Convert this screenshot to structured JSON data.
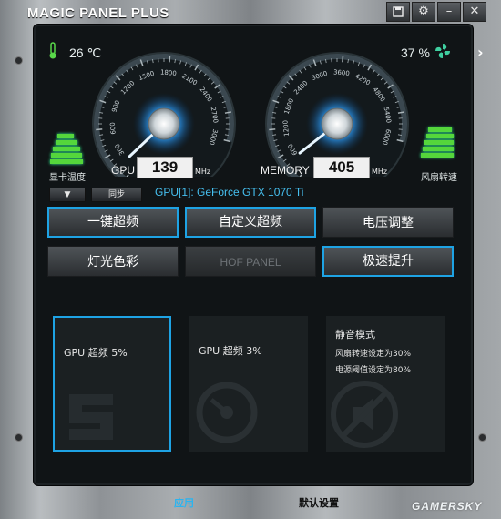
{
  "window": {
    "title": "MAGIC PANEL PLUS",
    "titlebar_buttons": [
      "save-icon",
      "gear-icon",
      "minimize-icon",
      "close-icon"
    ]
  },
  "sensors": {
    "gpu_temp": "26 ℃",
    "temp_label": "显卡温度",
    "fan_speed": "37 %",
    "fan_label": "风扇转速"
  },
  "gauges": {
    "gpu": {
      "label": "GPU",
      "value": "139",
      "unit": "MHz",
      "ticks": [
        "300",
        "600",
        "900",
        "1200",
        "1500",
        "1800",
        "2100",
        "2400",
        "2700",
        "3000"
      ]
    },
    "memory": {
      "label": "MEMORY",
      "value": "405",
      "unit": "MHz",
      "ticks": [
        "600",
        "1200",
        "1800",
        "2400",
        "3000",
        "3600",
        "4200",
        "4800",
        "5400",
        "6000"
      ]
    }
  },
  "device": {
    "sync_label": "同步",
    "gpu_name": "GPU[1]: GeForce GTX 1070 Ti"
  },
  "menu": {
    "oneclick_oc": "一键超频",
    "custom_oc": "自定义超频",
    "voltage": "电压调整",
    "lighting": "灯光色彩",
    "hof_panel": "HOF PANEL",
    "speed_boost": "极速提升"
  },
  "modes": {
    "card1_title": "GPU 超频 5%",
    "card2_title": "GPU 超频 3%",
    "card3_title": "静音模式",
    "card3_line1": "风扇转速设定为30%",
    "card3_line2": "电源阈值设定为80%"
  },
  "footer": {
    "apply": "应用",
    "defaults": "默认设置"
  },
  "watermark": "GAMERSKY",
  "colors": {
    "accent": "#1ea3e4",
    "gauge_glow": "#2b8fe0",
    "bar_green": "#55d63b"
  }
}
